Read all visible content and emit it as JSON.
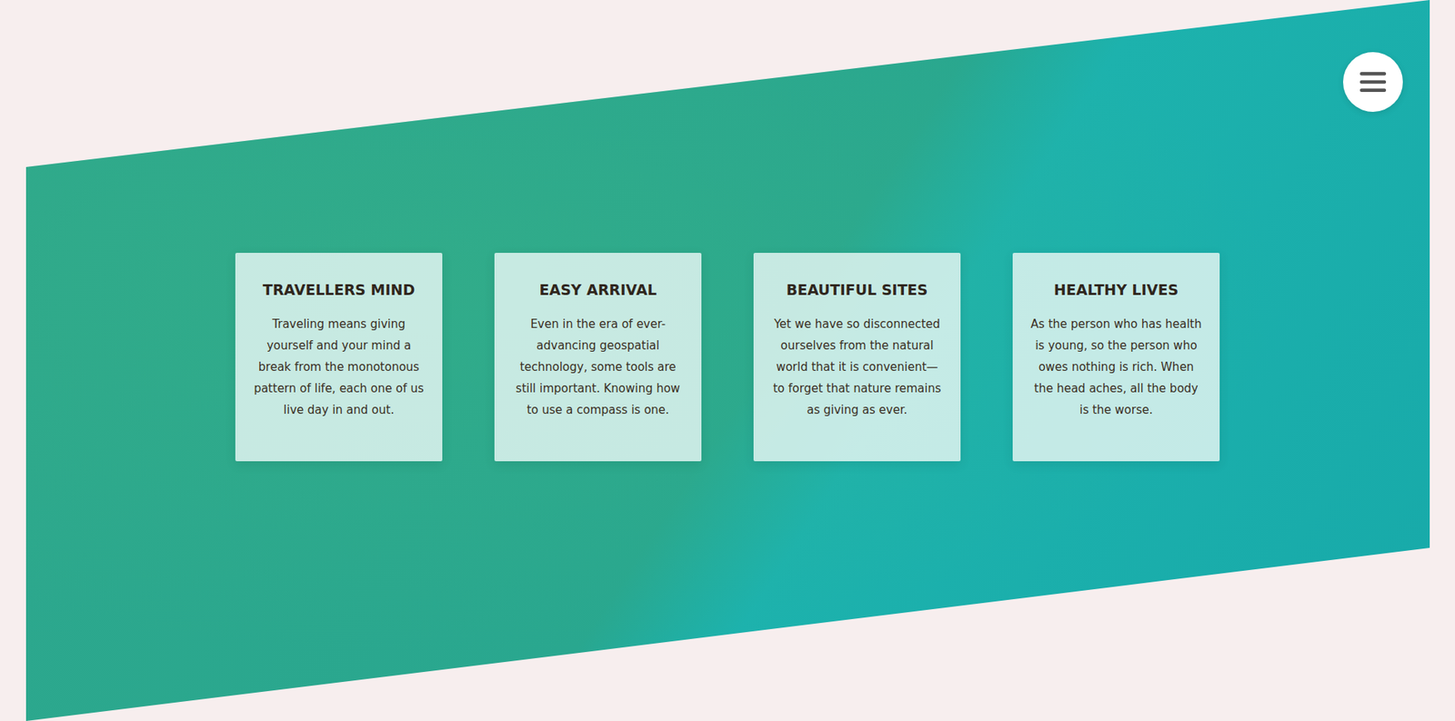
{
  "cards": [
    {
      "title": "TRAVELLERS MIND",
      "text": "Traveling means giving yourself and your mind a break from the monotonous pattern of life, each one of us live day in and out."
    },
    {
      "title": "EASY ARRIVAL",
      "text": "Even in the era of ever-advancing geospatial technology, some tools are still important. Knowing how to use a compass is one."
    },
    {
      "title": "BEAUTIFUL SITES",
      "text": "Yet we have so disconnected ourselves from the natural world that it is convenient—to forget that nature remains as giving as ever."
    },
    {
      "title": "HEALTHY LIVES",
      "text": "As the person who has health is young, so the person who owes nothing is rich. When the head aches, all the body is the worse."
    }
  ]
}
